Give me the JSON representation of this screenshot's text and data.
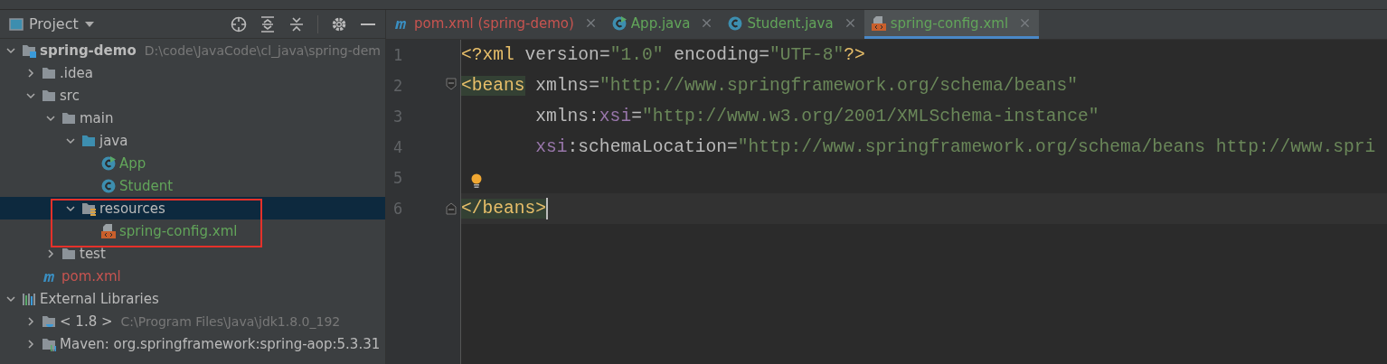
{
  "project_panel": {
    "title": "Project",
    "tree": [
      {
        "label": "spring-demo",
        "detail": "D:\\code\\JavaCode\\cl_java\\spring-dem",
        "kind": "project",
        "expanded": true,
        "selected": false,
        "color": "#bbbbbb",
        "children": [
          {
            "label": ".idea",
            "kind": "folder",
            "expanded": false,
            "selected": false,
            "color": "#bbbbbb"
          },
          {
            "label": "src",
            "kind": "folder",
            "expanded": true,
            "selected": false,
            "color": "#bbbbbb",
            "children": [
              {
                "label": "main",
                "kind": "folder",
                "expanded": true,
                "selected": false,
                "color": "#bbbbbb",
                "children": [
                  {
                    "label": "java",
                    "kind": "source-folder",
                    "expanded": true,
                    "selected": false,
                    "color": "#bbbbbb",
                    "children": [
                      {
                        "label": "App",
                        "kind": "main-class",
                        "selected": false,
                        "color": "#62a55a"
                      },
                      {
                        "label": "Student",
                        "kind": "class",
                        "selected": false,
                        "color": "#62a55a"
                      }
                    ]
                  },
                  {
                    "label": "resources",
                    "kind": "resources-folder",
                    "expanded": true,
                    "selected": true,
                    "color": "#bbbbbb",
                    "children": [
                      {
                        "label": "spring-config.xml",
                        "kind": "xml",
                        "selected": false,
                        "color": "#62a55a"
                      }
                    ]
                  }
                ]
              },
              {
                "label": "test",
                "kind": "folder",
                "expanded": false,
                "selected": false,
                "color": "#bbbbbb"
              }
            ]
          },
          {
            "label": "pom.xml",
            "kind": "maven",
            "selected": false,
            "color": "#c75450"
          }
        ]
      },
      {
        "label": "External Libraries",
        "kind": "libraries",
        "expanded": true,
        "selected": false,
        "color": "#bbbbbb",
        "children": [
          {
            "label": "< 1.8 >",
            "detail": "C:\\Program Files\\Java\\jdk1.8.0_192",
            "kind": "jdk",
            "expanded": false,
            "selected": false,
            "color": "#bbbbbb"
          },
          {
            "label": "Maven: org.springframework:spring-aop:5.3.31",
            "kind": "library",
            "expanded": false,
            "selected": false,
            "color": "#bbbbbb"
          }
        ]
      }
    ]
  },
  "editor_tabs": [
    {
      "label": "pom.xml (spring-demo)",
      "kind": "maven",
      "selected": false,
      "color": "#c75450"
    },
    {
      "label": "App.java",
      "kind": "main-class",
      "selected": false,
      "color": "#62a55a"
    },
    {
      "label": "Student.java",
      "kind": "class",
      "selected": false,
      "color": "#62a55a"
    },
    {
      "label": "spring-config.xml",
      "kind": "xml",
      "selected": true,
      "color": "#62a55a"
    }
  ],
  "editor": {
    "lines": [
      {
        "number": "1",
        "current": false,
        "bulb": false,
        "tokens": [
          {
            "kind": "tag",
            "text": "<?xml"
          },
          {
            "kind": "attr",
            "text": " version"
          },
          {
            "kind": "eq",
            "text": "="
          },
          {
            "kind": "string",
            "text": "\"1.0\""
          },
          {
            "kind": "attr",
            "text": " encoding"
          },
          {
            "kind": "eq",
            "text": "="
          },
          {
            "kind": "string",
            "text": "\"UTF-8\""
          },
          {
            "kind": "tag",
            "text": "?>"
          }
        ]
      },
      {
        "number": "2",
        "fold_open": true,
        "current": false,
        "bulb": false,
        "tokens": [
          {
            "kind": "tag",
            "text": "<beans",
            "matched": true
          },
          {
            "kind": "attr",
            "text": " xmlns"
          },
          {
            "kind": "eq",
            "text": "="
          },
          {
            "kind": "string",
            "text": "\"http://www.springframework.org/schema/beans\""
          }
        ]
      },
      {
        "number": "3",
        "current": false,
        "bulb": false,
        "tokens": [
          {
            "kind": "attr",
            "text": "       xmlns:"
          },
          {
            "kind": "ns",
            "text": "xsi"
          },
          {
            "kind": "eq",
            "text": "="
          },
          {
            "kind": "string",
            "text": "\"http://www.w3.org/2001/XMLSchema-instance\""
          }
        ]
      },
      {
        "number": "4",
        "current": false,
        "bulb": false,
        "tokens": [
          {
            "kind": "ns",
            "text": "       xsi"
          },
          {
            "kind": "attr",
            "text": ":schemaLocation"
          },
          {
            "kind": "eq",
            "text": "="
          },
          {
            "kind": "string",
            "text": "\"http://www.springframework.org/schema/beans http://www.spri"
          }
        ]
      },
      {
        "number": "5",
        "current": false,
        "bulb": true
      },
      {
        "number": "6",
        "fold_close": true,
        "current": true,
        "bulb": false,
        "tokens": [
          {
            "kind": "tag",
            "text": "</beans>",
            "matched": true
          }
        ]
      }
    ]
  }
}
